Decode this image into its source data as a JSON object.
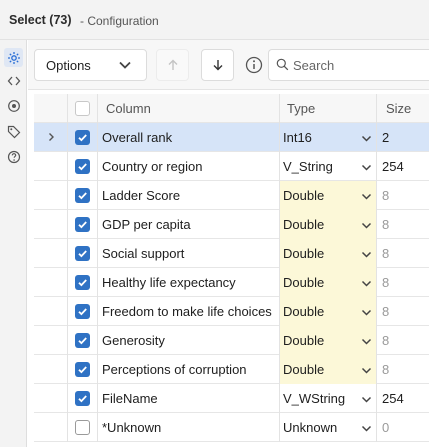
{
  "title": {
    "main": "Select (73)",
    "sub": "- Configuration"
  },
  "sidebar": {
    "icons": [
      "gear-icon",
      "code-brackets-icon",
      "target-icon",
      "tag-icon",
      "help-icon"
    ]
  },
  "toolbar": {
    "options_label": "Options",
    "search_placeholder": "Search"
  },
  "grid": {
    "headers": {
      "column": "Column",
      "type": "Type",
      "size": "Size"
    },
    "rows": [
      {
        "name": "Overall rank",
        "type": "Int16",
        "size": "2",
        "checked": true,
        "selected": true,
        "type_highlight": false,
        "size_muted": false
      },
      {
        "name": "Country or region",
        "type": "V_String",
        "size": "254",
        "checked": true,
        "selected": false,
        "type_highlight": false,
        "size_muted": false
      },
      {
        "name": "Ladder Score",
        "type": "Double",
        "size": "8",
        "checked": true,
        "selected": false,
        "type_highlight": true,
        "size_muted": true
      },
      {
        "name": "GDP per capita",
        "type": "Double",
        "size": "8",
        "checked": true,
        "selected": false,
        "type_highlight": true,
        "size_muted": true
      },
      {
        "name": "Social support",
        "type": "Double",
        "size": "8",
        "checked": true,
        "selected": false,
        "type_highlight": true,
        "size_muted": true
      },
      {
        "name": "Healthy life expectancy",
        "type": "Double",
        "size": "8",
        "checked": true,
        "selected": false,
        "type_highlight": true,
        "size_muted": true
      },
      {
        "name": "Freedom to make life choices",
        "type": "Double",
        "size": "8",
        "checked": true,
        "selected": false,
        "type_highlight": true,
        "size_muted": true
      },
      {
        "name": "Generosity",
        "type": "Double",
        "size": "8",
        "checked": true,
        "selected": false,
        "type_highlight": true,
        "size_muted": true
      },
      {
        "name": "Perceptions of corruption",
        "type": "Double",
        "size": "8",
        "checked": true,
        "selected": false,
        "type_highlight": true,
        "size_muted": true
      },
      {
        "name": "FileName",
        "type": "V_WString",
        "size": "254",
        "checked": true,
        "selected": false,
        "type_highlight": false,
        "size_muted": false
      },
      {
        "name": "*Unknown",
        "type": "Unknown",
        "size": "0",
        "checked": false,
        "selected": false,
        "type_highlight": false,
        "size_muted": true
      }
    ]
  },
  "colors": {
    "accent": "#2f72c4",
    "selected_row": "#d6e4f8",
    "type_highlight": "#fcf8d8"
  }
}
